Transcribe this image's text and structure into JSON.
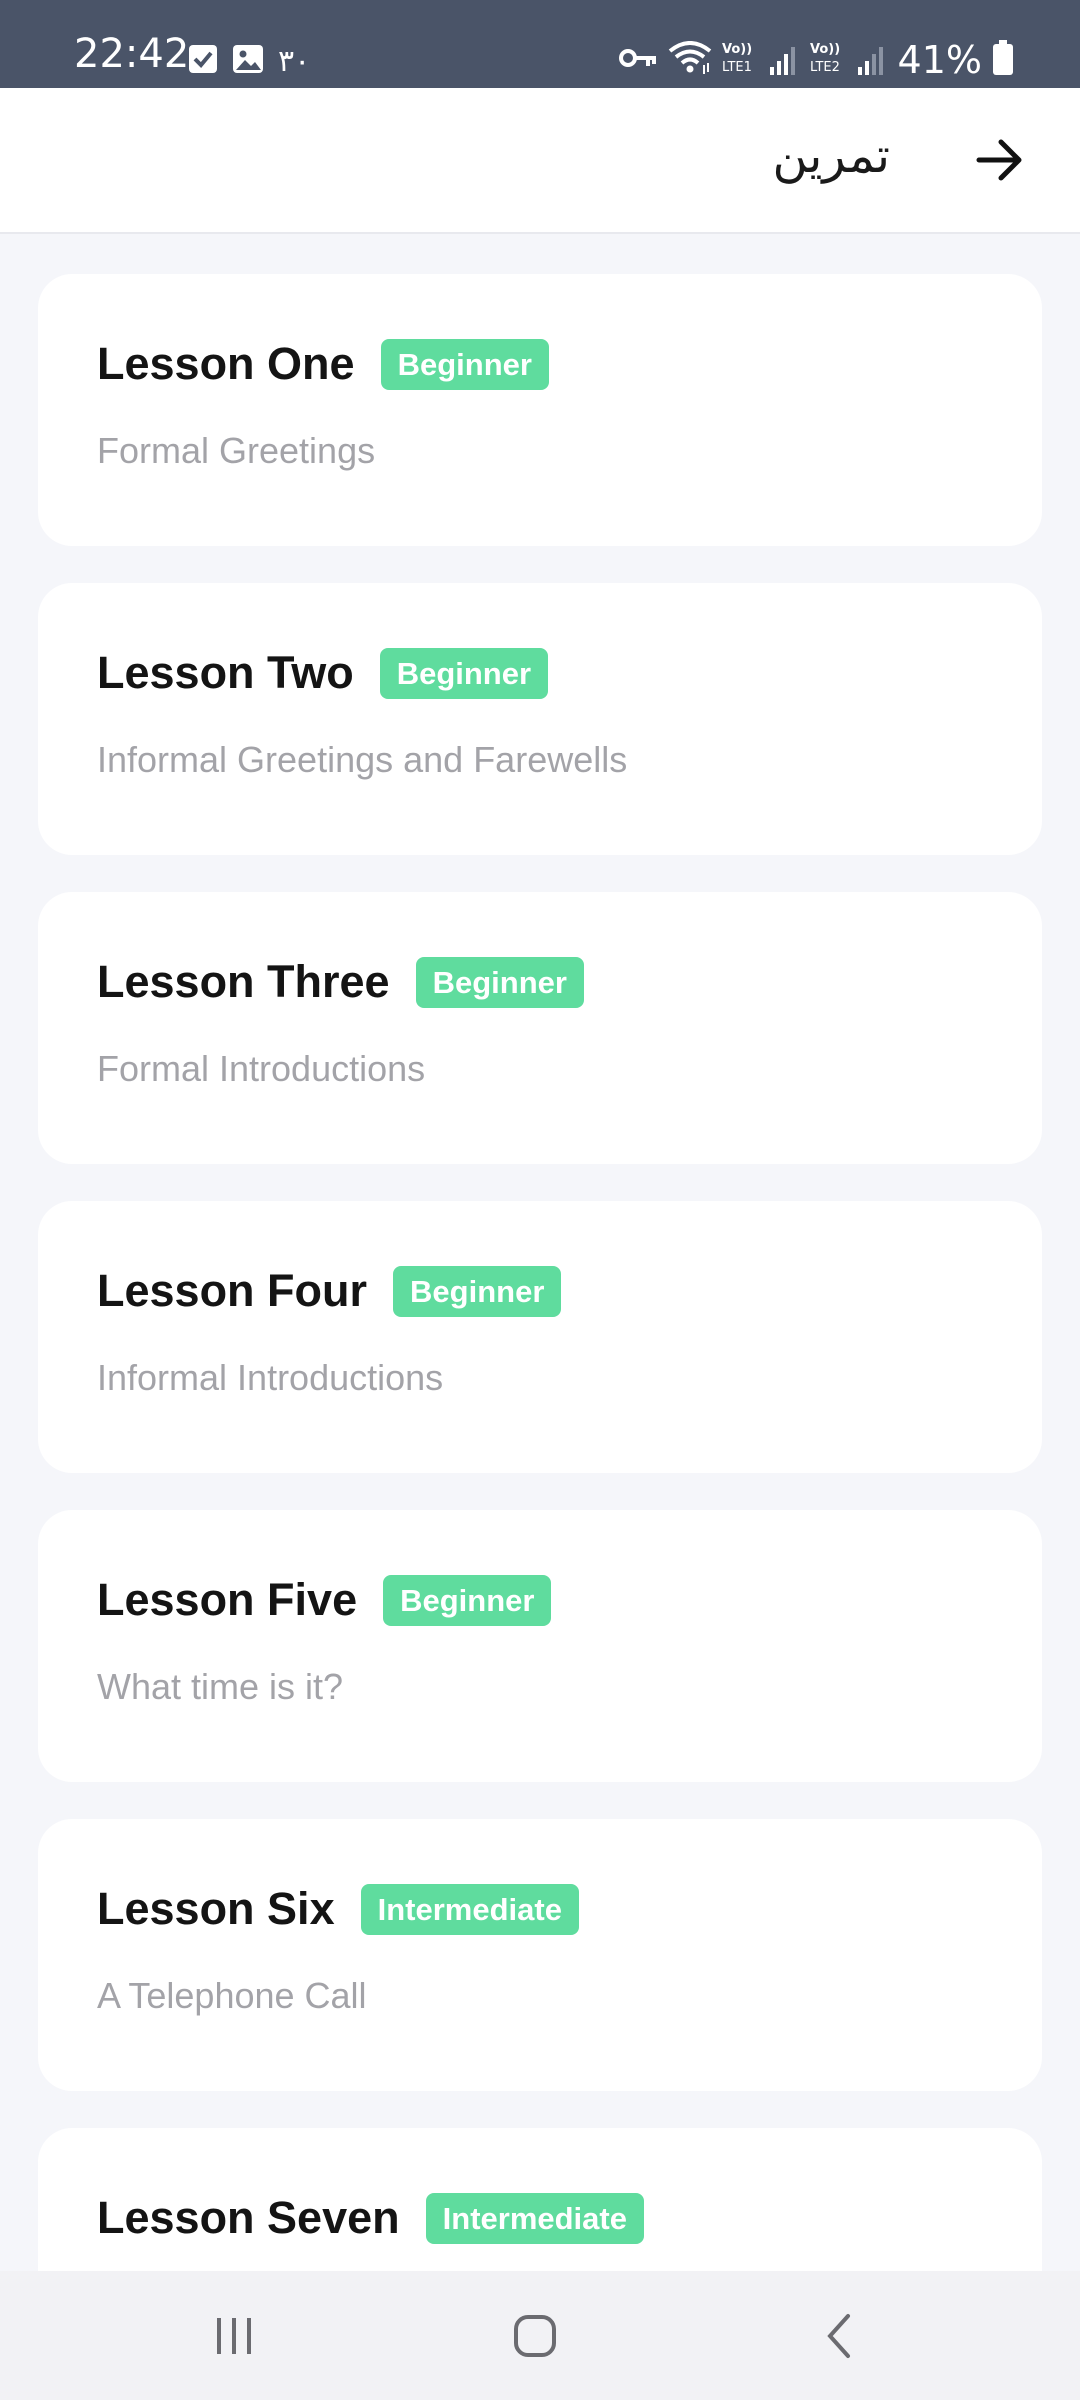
{
  "status_bar": {
    "time": "22:42",
    "notification_count": "۳۰",
    "battery_percent": "41%",
    "left_icons": [
      "task-check-icon",
      "gallery-icon"
    ],
    "right_icons": [
      "vpn-key-icon",
      "wifi-icon",
      "lte1-signal-icon",
      "lte2-signal-icon",
      "battery-icon"
    ],
    "lte1_label": "Vo)) LTE1",
    "lte2_label": "Vo)) LTE2"
  },
  "app_bar": {
    "title": "تمرین",
    "back_icon": "arrow-right-icon"
  },
  "colors": {
    "status_bar_bg": "#4a5468",
    "badge_bg": "#5fdc9e",
    "page_bg": "#f5f6fa",
    "card_bg": "#ffffff",
    "subtitle": "#a3a3a8"
  },
  "lessons": [
    {
      "title": "Lesson One",
      "level": "Beginner",
      "subtitle": "Formal Greetings"
    },
    {
      "title": "Lesson Two",
      "level": "Beginner",
      "subtitle": "Informal Greetings and Farewells"
    },
    {
      "title": "Lesson Three",
      "level": "Beginner",
      "subtitle": "Formal Introductions"
    },
    {
      "title": "Lesson Four",
      "level": "Beginner",
      "subtitle": "Informal Introductions"
    },
    {
      "title": "Lesson Five",
      "level": "Beginner",
      "subtitle": "What time is it?"
    },
    {
      "title": "Lesson Six",
      "level": "Intermediate",
      "subtitle": "A Telephone Call"
    },
    {
      "title": "Lesson Seven",
      "level": "Intermediate",
      "subtitle": ""
    }
  ],
  "nav_bar": {
    "icons": [
      "recent-apps-icon",
      "home-icon",
      "back-icon"
    ]
  }
}
